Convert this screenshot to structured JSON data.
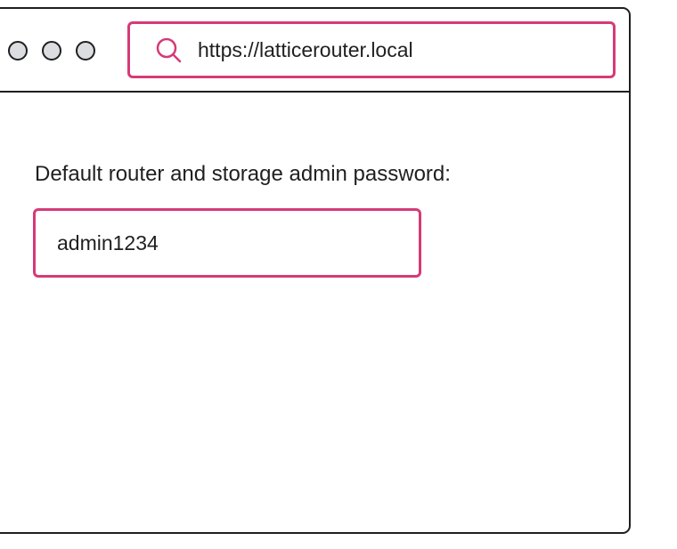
{
  "browser": {
    "address_bar": {
      "url": "https://latticerouter.local",
      "icon": "search-icon"
    },
    "window_controls": [
      "window-dot",
      "window-dot",
      "window-dot"
    ]
  },
  "page": {
    "password_label": "Default router and storage admin password:",
    "password_value": "admin1234"
  },
  "colors": {
    "accent": "#d63a78",
    "border": "#1f1f1f",
    "dot_fill": "#dcdde0",
    "background": "#ffffff"
  }
}
